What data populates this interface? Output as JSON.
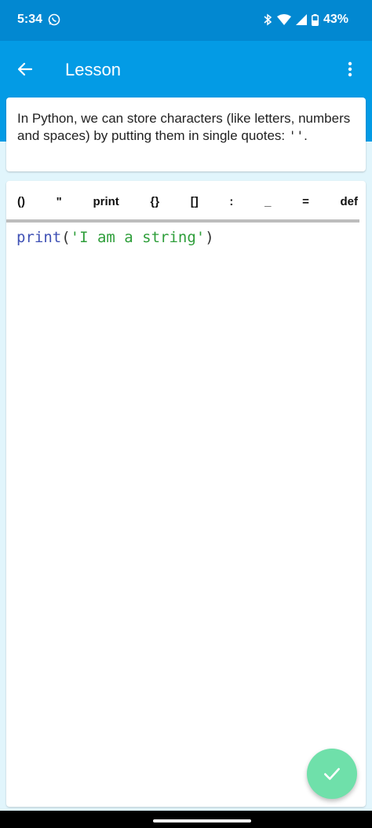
{
  "status_bar": {
    "time": "5:34",
    "battery": "43%",
    "icons": [
      "whatsapp-icon",
      "bluetooth-icon",
      "wifi-icon",
      "signal-icon",
      "battery-icon"
    ]
  },
  "app_bar": {
    "title": "Lesson",
    "icons": [
      "back-arrow-icon",
      "more-vert-icon"
    ]
  },
  "lesson": {
    "text": "In Python, we can store characters (like letters, numbers and spaces) by putting them in single quotes: ",
    "quotes": "''",
    "end": "."
  },
  "snippets": [
    "()",
    "\"",
    "print",
    "{}",
    "[]",
    ":",
    "_",
    "=",
    "def"
  ],
  "code": {
    "fn": "print",
    "open": "(",
    "string": "'I am a string'",
    "close": ")"
  },
  "fab": {
    "icon": "check-icon"
  },
  "colors": {
    "status_bar": "#0288d1",
    "app_bar": "#039be5",
    "background": "#e1f5fc",
    "fab": "#6fe0aa",
    "code_function": "#3f51b5",
    "code_string": "#2e9e3a"
  }
}
